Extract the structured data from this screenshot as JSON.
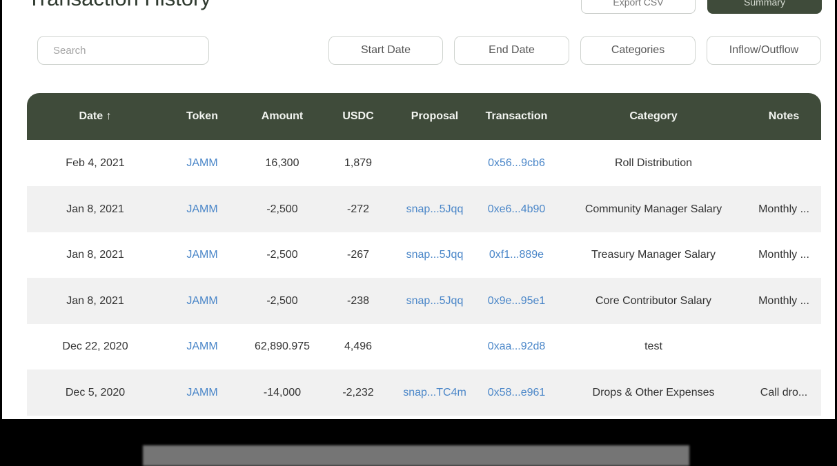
{
  "page": {
    "title": "Transaction History",
    "export_label": "Export CSV",
    "summary_label": "Summary"
  },
  "filters": {
    "search_placeholder": "Search",
    "start_date": "Start Date",
    "end_date": "End Date",
    "categories": "Categories",
    "flow": "Inflow/Outflow"
  },
  "table": {
    "columns": {
      "date": "Date ↑",
      "token": "Token",
      "amount": "Amount",
      "usdc": "USDC",
      "proposal": "Proposal",
      "transaction": "Transaction",
      "category": "Category",
      "notes": "Notes"
    },
    "rows": [
      {
        "date": "Feb 4, 2021",
        "token": "JAMM",
        "amount": "16,300",
        "usdc": "1,879",
        "proposal": "",
        "transaction": "0x56...9cb6",
        "category": "Roll Distribution",
        "notes": ""
      },
      {
        "date": "Jan 8, 2021",
        "token": "JAMM",
        "amount": "-2,500",
        "usdc": "-272",
        "proposal": "snap...5Jqq",
        "transaction": "0xe6...4b90",
        "category": "Community Manager Salary",
        "notes": "Monthly ..."
      },
      {
        "date": "Jan 8, 2021",
        "token": "JAMM",
        "amount": "-2,500",
        "usdc": "-267",
        "proposal": "snap...5Jqq",
        "transaction": "0xf1...889e",
        "category": "Treasury Manager Salary",
        "notes": "Monthly ..."
      },
      {
        "date": "Jan 8, 2021",
        "token": "JAMM",
        "amount": "-2,500",
        "usdc": "-238",
        "proposal": "snap...5Jqq",
        "transaction": "0x9e...95e1",
        "category": "Core Contributor Salary",
        "notes": "Monthly ..."
      },
      {
        "date": "Dec 22, 2020",
        "token": "JAMM",
        "amount": "62,890.975",
        "usdc": "4,496",
        "proposal": "",
        "transaction": "0xaa...92d8",
        "category": "test",
        "notes": ""
      },
      {
        "date": "Dec 5, 2020",
        "token": "JAMM",
        "amount": "-14,000",
        "usdc": "-2,232",
        "proposal": "snap...TC4m",
        "transaction": "0x58...e961",
        "category": "Drops & Other Expenses",
        "notes": "Call dro..."
      }
    ]
  },
  "colors": {
    "header_bg": "#3f4b3a",
    "link": "#4a86c8",
    "alt_row": "#f1f1f1"
  }
}
